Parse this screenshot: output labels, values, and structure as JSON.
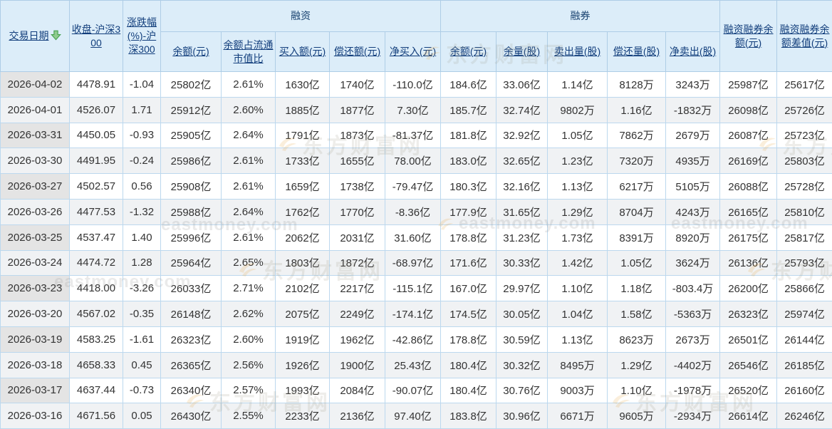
{
  "table": {
    "groups": {
      "financing": "融资",
      "securities_lending": "融券"
    },
    "sort": {
      "column": "trade_date",
      "direction": "desc"
    },
    "columns": [
      {
        "id": "trade_date",
        "label": "交易日期"
      },
      {
        "id": "close_hs300",
        "label": "收盘-沪深300"
      },
      {
        "id": "change_pct_hs300",
        "label": "涨跌幅(%)-沪深300"
      },
      {
        "id": "rz_balance",
        "label": "余额(元)"
      },
      {
        "id": "rz_balance_ratio",
        "label": "余额占流通市值比"
      },
      {
        "id": "rz_buy",
        "label": "买入额(元)"
      },
      {
        "id": "rz_repay",
        "label": "偿还额(元)"
      },
      {
        "id": "rz_net_buy",
        "label": "净买入(元)"
      },
      {
        "id": "rq_balance",
        "label": "余额(元)"
      },
      {
        "id": "rq_volume",
        "label": "余量(股)"
      },
      {
        "id": "rq_sell_volume",
        "label": "卖出量(股)"
      },
      {
        "id": "rq_repay_volume",
        "label": "偿还量(股)"
      },
      {
        "id": "rq_net_sell",
        "label": "净卖出(股)"
      },
      {
        "id": "rzrq_balance",
        "label": "融资融券余额(元)"
      },
      {
        "id": "rzrq_balance_diff",
        "label": "融资融券余额差值(元)"
      }
    ],
    "rows": [
      [
        [
          "2026-04-02",
          "n"
        ],
        [
          "4478.91",
          "g"
        ],
        [
          "-1.04",
          "g"
        ],
        [
          "25802亿",
          "n"
        ],
        [
          "2.61%",
          "n"
        ],
        [
          "1630亿",
          "n"
        ],
        [
          "1740亿",
          "n"
        ],
        [
          "-110.0亿",
          "g"
        ],
        [
          "184.6亿",
          "n"
        ],
        [
          "33.06亿",
          "n"
        ],
        [
          "1.14亿",
          "n"
        ],
        [
          "8128万",
          "n"
        ],
        [
          "3243万",
          "r"
        ],
        [
          "25987亿",
          "n"
        ],
        [
          "25617亿",
          "n"
        ]
      ],
      [
        [
          "2026-04-01",
          "n"
        ],
        [
          "4526.07",
          "r"
        ],
        [
          "1.71",
          "r"
        ],
        [
          "25912亿",
          "n"
        ],
        [
          "2.60%",
          "n"
        ],
        [
          "1885亿",
          "n"
        ],
        [
          "1877亿",
          "n"
        ],
        [
          "7.30亿",
          "r"
        ],
        [
          "185.7亿",
          "n"
        ],
        [
          "32.74亿",
          "n"
        ],
        [
          "9802万",
          "n"
        ],
        [
          "1.16亿",
          "n"
        ],
        [
          "-1832万",
          "g"
        ],
        [
          "26098亿",
          "n"
        ],
        [
          "25726亿",
          "n"
        ]
      ],
      [
        [
          "2026-03-31",
          "n"
        ],
        [
          "4450.05",
          "g"
        ],
        [
          "-0.93",
          "g"
        ],
        [
          "25905亿",
          "n"
        ],
        [
          "2.64%",
          "n"
        ],
        [
          "1791亿",
          "n"
        ],
        [
          "1873亿",
          "n"
        ],
        [
          "-81.37亿",
          "g"
        ],
        [
          "181.8亿",
          "n"
        ],
        [
          "32.92亿",
          "n"
        ],
        [
          "1.05亿",
          "n"
        ],
        [
          "7862万",
          "n"
        ],
        [
          "2679万",
          "r"
        ],
        [
          "26087亿",
          "n"
        ],
        [
          "25723亿",
          "n"
        ]
      ],
      [
        [
          "2026-03-30",
          "n"
        ],
        [
          "4491.95",
          "g"
        ],
        [
          "-0.24",
          "g"
        ],
        [
          "25986亿",
          "n"
        ],
        [
          "2.61%",
          "n"
        ],
        [
          "1733亿",
          "n"
        ],
        [
          "1655亿",
          "n"
        ],
        [
          "78.00亿",
          "r"
        ],
        [
          "183.0亿",
          "n"
        ],
        [
          "32.65亿",
          "n"
        ],
        [
          "1.23亿",
          "n"
        ],
        [
          "7320万",
          "n"
        ],
        [
          "4935万",
          "r"
        ],
        [
          "26169亿",
          "n"
        ],
        [
          "25803亿",
          "n"
        ]
      ],
      [
        [
          "2026-03-27",
          "n"
        ],
        [
          "4502.57",
          "r"
        ],
        [
          "0.56",
          "r"
        ],
        [
          "25908亿",
          "n"
        ],
        [
          "2.61%",
          "n"
        ],
        [
          "1659亿",
          "n"
        ],
        [
          "1738亿",
          "n"
        ],
        [
          "-79.47亿",
          "g"
        ],
        [
          "180.3亿",
          "n"
        ],
        [
          "32.16亿",
          "n"
        ],
        [
          "1.13亿",
          "n"
        ],
        [
          "6217万",
          "n"
        ],
        [
          "5105万",
          "r"
        ],
        [
          "26088亿",
          "n"
        ],
        [
          "25728亿",
          "n"
        ]
      ],
      [
        [
          "2026-03-26",
          "n"
        ],
        [
          "4477.53",
          "g"
        ],
        [
          "-1.32",
          "g"
        ],
        [
          "25988亿",
          "n"
        ],
        [
          "2.64%",
          "n"
        ],
        [
          "1762亿",
          "n"
        ],
        [
          "1770亿",
          "n"
        ],
        [
          "-8.36亿",
          "g"
        ],
        [
          "177.9亿",
          "n"
        ],
        [
          "31.65亿",
          "n"
        ],
        [
          "1.29亿",
          "n"
        ],
        [
          "8704万",
          "n"
        ],
        [
          "4243万",
          "r"
        ],
        [
          "26165亿",
          "n"
        ],
        [
          "25810亿",
          "n"
        ]
      ],
      [
        [
          "2026-03-25",
          "n"
        ],
        [
          "4537.47",
          "r"
        ],
        [
          "1.40",
          "r"
        ],
        [
          "25996亿",
          "n"
        ],
        [
          "2.61%",
          "n"
        ],
        [
          "2062亿",
          "n"
        ],
        [
          "2031亿",
          "n"
        ],
        [
          "31.60亿",
          "r"
        ],
        [
          "178.8亿",
          "n"
        ],
        [
          "31.23亿",
          "n"
        ],
        [
          "1.73亿",
          "n"
        ],
        [
          "8391万",
          "n"
        ],
        [
          "8920万",
          "r"
        ],
        [
          "26175亿",
          "n"
        ],
        [
          "25817亿",
          "n"
        ]
      ],
      [
        [
          "2026-03-24",
          "n"
        ],
        [
          "4474.72",
          "r"
        ],
        [
          "1.28",
          "r"
        ],
        [
          "25964亿",
          "n"
        ],
        [
          "2.65%",
          "n"
        ],
        [
          "1803亿",
          "n"
        ],
        [
          "1872亿",
          "n"
        ],
        [
          "-68.97亿",
          "g"
        ],
        [
          "171.6亿",
          "n"
        ],
        [
          "30.33亿",
          "n"
        ],
        [
          "1.42亿",
          "n"
        ],
        [
          "1.05亿",
          "n"
        ],
        [
          "3624万",
          "r"
        ],
        [
          "26136亿",
          "n"
        ],
        [
          "25793亿",
          "n"
        ]
      ],
      [
        [
          "2026-03-23",
          "n"
        ],
        [
          "4418.00",
          "g"
        ],
        [
          "-3.26",
          "g"
        ],
        [
          "26033亿",
          "n"
        ],
        [
          "2.71%",
          "n"
        ],
        [
          "2102亿",
          "n"
        ],
        [
          "2217亿",
          "n"
        ],
        [
          "-115.1亿",
          "g"
        ],
        [
          "167.0亿",
          "n"
        ],
        [
          "29.97亿",
          "n"
        ],
        [
          "1.10亿",
          "n"
        ],
        [
          "1.18亿",
          "n"
        ],
        [
          "-803.4万",
          "g"
        ],
        [
          "26200亿",
          "n"
        ],
        [
          "25866亿",
          "n"
        ]
      ],
      [
        [
          "2026-03-20",
          "n"
        ],
        [
          "4567.02",
          "g"
        ],
        [
          "-0.35",
          "g"
        ],
        [
          "26148亿",
          "n"
        ],
        [
          "2.62%",
          "n"
        ],
        [
          "2075亿",
          "n"
        ],
        [
          "2249亿",
          "n"
        ],
        [
          "-174.1亿",
          "g"
        ],
        [
          "174.5亿",
          "n"
        ],
        [
          "30.05亿",
          "n"
        ],
        [
          "1.04亿",
          "n"
        ],
        [
          "1.58亿",
          "n"
        ],
        [
          "-5363万",
          "g"
        ],
        [
          "26323亿",
          "n"
        ],
        [
          "25974亿",
          "n"
        ]
      ],
      [
        [
          "2026-03-19",
          "n"
        ],
        [
          "4583.25",
          "g"
        ],
        [
          "-1.61",
          "g"
        ],
        [
          "26323亿",
          "n"
        ],
        [
          "2.60%",
          "n"
        ],
        [
          "1919亿",
          "n"
        ],
        [
          "1962亿",
          "n"
        ],
        [
          "-42.86亿",
          "g"
        ],
        [
          "178.8亿",
          "n"
        ],
        [
          "30.59亿",
          "n"
        ],
        [
          "1.13亿",
          "n"
        ],
        [
          "8623万",
          "n"
        ],
        [
          "2673万",
          "r"
        ],
        [
          "26501亿",
          "n"
        ],
        [
          "26144亿",
          "n"
        ]
      ],
      [
        [
          "2026-03-18",
          "n"
        ],
        [
          "4658.33",
          "r"
        ],
        [
          "0.45",
          "r"
        ],
        [
          "26365亿",
          "n"
        ],
        [
          "2.56%",
          "n"
        ],
        [
          "1926亿",
          "n"
        ],
        [
          "1900亿",
          "n"
        ],
        [
          "25.43亿",
          "r"
        ],
        [
          "180.4亿",
          "n"
        ],
        [
          "30.32亿",
          "n"
        ],
        [
          "8495万",
          "n"
        ],
        [
          "1.29亿",
          "n"
        ],
        [
          "-4402万",
          "g"
        ],
        [
          "26546亿",
          "n"
        ],
        [
          "26185亿",
          "n"
        ]
      ],
      [
        [
          "2026-03-17",
          "n"
        ],
        [
          "4637.44",
          "g"
        ],
        [
          "-0.73",
          "g"
        ],
        [
          "26340亿",
          "n"
        ],
        [
          "2.57%",
          "n"
        ],
        [
          "1993亿",
          "n"
        ],
        [
          "2084亿",
          "n"
        ],
        [
          "-90.07亿",
          "g"
        ],
        [
          "180.4亿",
          "n"
        ],
        [
          "30.76亿",
          "n"
        ],
        [
          "9003万",
          "n"
        ],
        [
          "1.10亿",
          "n"
        ],
        [
          "-1978万",
          "g"
        ],
        [
          "26520亿",
          "n"
        ],
        [
          "26160亿",
          "n"
        ]
      ],
      [
        [
          "2026-03-16",
          "n"
        ],
        [
          "4671.56",
          "r"
        ],
        [
          "0.05",
          "r"
        ],
        [
          "26430亿",
          "n"
        ],
        [
          "2.55%",
          "n"
        ],
        [
          "2233亿",
          "n"
        ],
        [
          "2136亿",
          "n"
        ],
        [
          "97.40亿",
          "r"
        ],
        [
          "183.8亿",
          "n"
        ],
        [
          "30.96亿",
          "n"
        ],
        [
          "6671万",
          "n"
        ],
        [
          "9605万",
          "n"
        ],
        [
          "-2934万",
          "g"
        ],
        [
          "26614亿",
          "n"
        ],
        [
          "26246亿",
          "n"
        ]
      ]
    ]
  },
  "colors": {
    "up_red": "#ff0000",
    "down_green": "#009900",
    "header_bg": "#dcedf9",
    "header_text": "#123e7c",
    "date_col_bg": "#e4e4e4",
    "alt_row_bg": "#f0f2f4",
    "border_blue": "#bcd8ee",
    "sort_arrow_green": "#55ac5e",
    "watermark_orange": "#e8a33d"
  },
  "watermark": {
    "site_name": "东方财富网",
    "domain": "eastmoney.com"
  }
}
